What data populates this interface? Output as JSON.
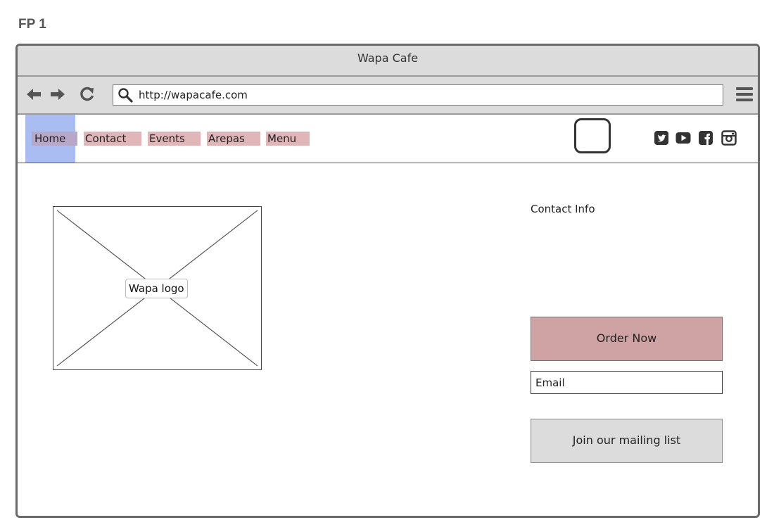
{
  "page_label": "FP 1",
  "window": {
    "title": "Wapa Cafe"
  },
  "toolbar": {
    "url": "http://wapacafe.com",
    "icons": [
      "back-arrow-icon",
      "forward-arrow-icon",
      "reload-icon",
      "search-icon",
      "hamburger-menu-icon"
    ]
  },
  "nav": {
    "links": [
      {
        "label": "Home",
        "active": true
      },
      {
        "label": "Contact"
      },
      {
        "label": "Events"
      },
      {
        "label": "Arepas"
      },
      {
        "label": "Menu"
      }
    ],
    "social_icons": [
      "twitter-icon",
      "youtube-icon",
      "facebook-icon",
      "instagram-icon"
    ]
  },
  "main": {
    "logo_label": "Wapa logo",
    "contact_heading": "Contact Info",
    "order_button": "Order Now",
    "email_placeholder": "Email",
    "join_button": "Join our mailing list"
  },
  "colors": {
    "nav_link_bg": "#e0b6b8",
    "home_highlight": "#a9bdf2",
    "order_button": "#cfa3a4",
    "chrome_gray": "#dcdcdc"
  }
}
